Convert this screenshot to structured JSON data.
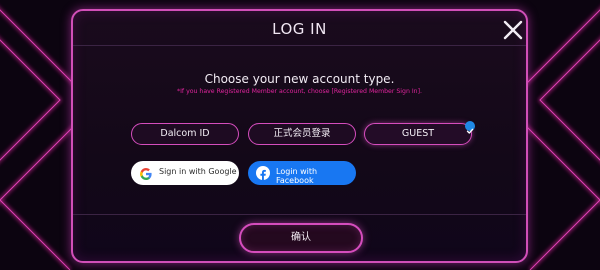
{
  "dialog": {
    "title": "LOG IN",
    "close_icon": "close-icon"
  },
  "prompt": {
    "heading": "Choose your new account type.",
    "note": "*If you have Registered Member account, choose [Registered Member Sign In]."
  },
  "account_types": [
    {
      "label": "Dalcom ID",
      "selected": false
    },
    {
      "label": "正式会员登录",
      "selected": false
    },
    {
      "label": "GUEST",
      "selected": true
    }
  ],
  "social": {
    "google_label": "Sign in with Google",
    "facebook_label": "Login with Facebook"
  },
  "confirm_label": "确认",
  "colors": {
    "accent": "#d54dbd",
    "note": "#e0259d",
    "facebook": "#1877f2",
    "check": "#1e88e5"
  }
}
